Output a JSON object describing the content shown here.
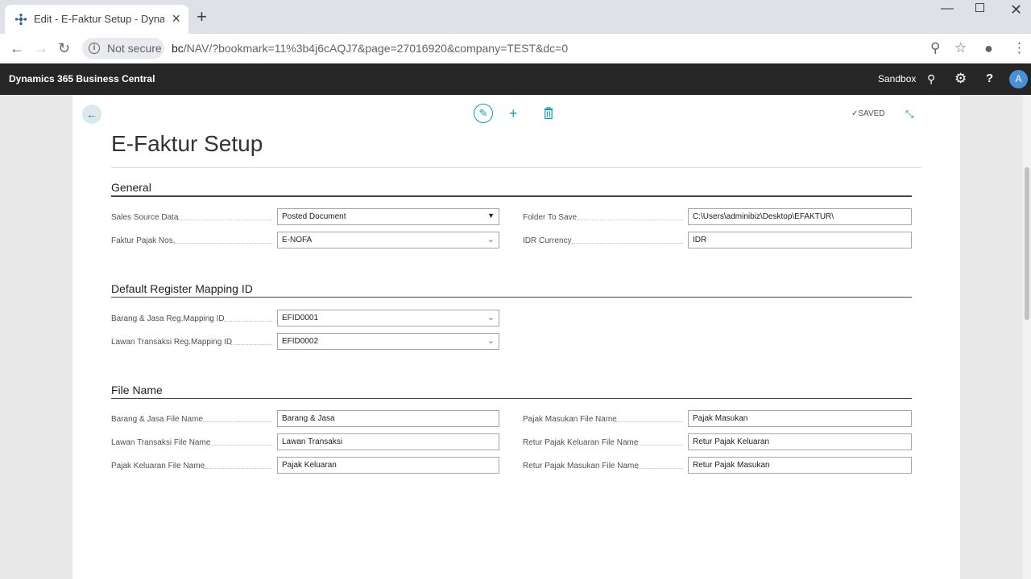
{
  "browser": {
    "tab_title": "Edit - E-Faktur Setup - Dynamics",
    "security_label": "Not secure",
    "url_host": "bc",
    "url_path": "/NAV/?bookmark=11%3b4j6cAQJ7&page=27016920&company=TEST&dc=0"
  },
  "app": {
    "brand": "Dynamics 365 Business Central",
    "environment": "Sandbox",
    "avatar_initial": "A"
  },
  "page": {
    "title": "E-Faktur Setup",
    "saved_label": "SAVED"
  },
  "sections": {
    "general": {
      "heading": "General",
      "sales_source_data_label": "Sales Source Data",
      "sales_source_data_value": "Posted Document",
      "faktur_pajak_nos_label": "Faktur Pajak Nos.",
      "faktur_pajak_nos_value": "E-NOFA",
      "folder_to_save_label": "Folder To Save",
      "folder_to_save_value": "C:\\Users\\adminibiz\\Desktop\\EFAKTUR\\",
      "idr_currency_label": "IDR Currency",
      "idr_currency_value": "IDR"
    },
    "mapping": {
      "heading": "Default Register Mapping ID",
      "barang_jasa_label": "Barang & Jasa Reg.Mapping ID",
      "barang_jasa_value": "EFID0001",
      "lawan_transaksi_label": "Lawan Transaksi Reg.Mapping ID",
      "lawan_transaksi_value": "EFID0002"
    },
    "filename": {
      "heading": "File Name",
      "barang_jasa_label": "Barang & Jasa File Name",
      "barang_jasa_value": "Barang & Jasa",
      "lawan_transaksi_label": "Lawan Transaksi File Name",
      "lawan_transaksi_value": "Lawan Transaksi",
      "pajak_keluaran_label": "Pajak Keluaran File Name",
      "pajak_keluaran_value": "Pajak Keluaran",
      "pajak_masukan_label": "Pajak Masukan File Name",
      "pajak_masukan_value": "Pajak Masukan",
      "retur_keluaran_label": "Retur Pajak Keluaran File Name",
      "retur_keluaran_value": "Retur Pajak Keluaran",
      "retur_masukan_label": "Retur Pajak Masukan File Name",
      "retur_masukan_value": "Retur Pajak Masukan"
    }
  },
  "icons": {
    "brand_color": "#00a2b1"
  }
}
